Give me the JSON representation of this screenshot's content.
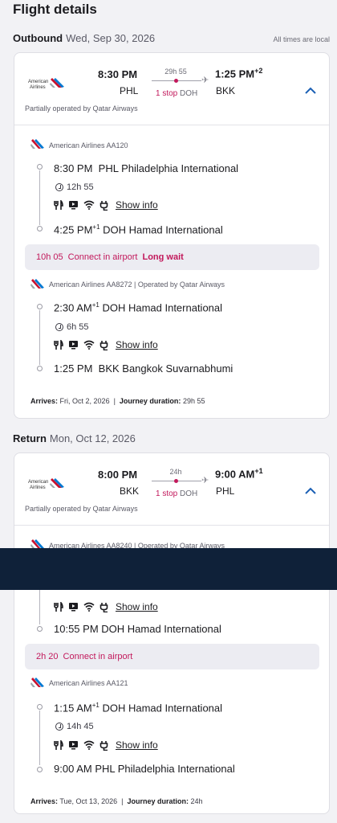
{
  "page": {
    "title": "Flight details",
    "times_note": "All times are local"
  },
  "outbound": {
    "label": "Outbound",
    "date": "Wed, Sep 30, 2026",
    "depart_time": "8:30 PM",
    "arrive_time": "1:25 PM",
    "arrive_offset": "+2",
    "from": "PHL",
    "to": "BKK",
    "duration": "29h 55",
    "stops": "1 stop",
    "stop_via": "DOH",
    "partial": "Partially operated by Qatar Airways",
    "segments": [
      {
        "airline": "American Airlines AA120",
        "dep_time": "8:30 PM",
        "dep_offset": "",
        "dep_airport": "PHL Philadelphia International",
        "flight_time": "12h 55",
        "arr_time": "4:25 PM",
        "arr_offset": "+1",
        "arr_airport": "DOH Hamad International",
        "show_info": "Show info"
      },
      {
        "airline": "American Airlines AA8272 | Operated by Qatar Airways",
        "dep_time": "2:30 AM",
        "dep_offset": "+1",
        "dep_airport": "DOH Hamad International",
        "flight_time": "6h 55",
        "arr_time": "1:25 PM",
        "arr_offset": "",
        "arr_airport": "BKK Bangkok Suvarnabhumi",
        "show_info": "Show info"
      }
    ],
    "layover": {
      "duration": "10h 05",
      "text": "Connect in airport",
      "flag": "Long wait"
    },
    "arrives_label": "Arrives:",
    "arrives_value": "Fri, Oct 2, 2026",
    "journey_label": "Journey duration:",
    "journey_value": "29h 55"
  },
  "return": {
    "label": "Return",
    "date": "Mon, Oct 12, 2026",
    "depart_time": "8:00 PM",
    "arrive_time": "9:00 AM",
    "arrive_offset": "+1",
    "from": "BKK",
    "to": "PHL",
    "duration": "24h",
    "stops": "1 stop",
    "stop_via": "DOH",
    "partial": "Partially operated by Qatar Airways",
    "segments": [
      {
        "airline": "American Airlines AA8240 | Operated by Qatar Airways",
        "arr_time": "10:55 PM",
        "arr_offset": "",
        "arr_airport": "DOH Hamad International",
        "show_info": "Show info"
      },
      {
        "airline": "American Airlines AA121",
        "dep_time": "1:15 AM",
        "dep_offset": "+1",
        "dep_airport": "DOH Hamad International",
        "flight_time": "14h 45",
        "arr_time": "9:00 AM",
        "arr_offset": "",
        "arr_airport": "PHL Philadelphia International",
        "show_info": "Show info"
      }
    ],
    "layover": {
      "duration": "2h 20",
      "text": "Connect in airport"
    },
    "arrives_label": "Arrives:",
    "arrives_value": "Tue, Oct 13, 2026",
    "journey_label": "Journey duration:",
    "journey_value": "24h"
  },
  "airline_logo": {
    "text_line1": "American",
    "text_line2": "Airlines"
  },
  "colors": {
    "accent": "#c2185b",
    "chevron": "#1a5fb4",
    "overlay": "#0f2139"
  }
}
